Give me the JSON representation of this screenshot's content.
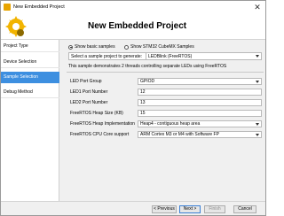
{
  "window": {
    "title": "New Embedded Project",
    "close_glyph": "✕"
  },
  "header": {
    "heading": "New Embedded Project"
  },
  "sidebar": {
    "items": [
      {
        "label": "Project Type"
      },
      {
        "label": "Device Selection"
      },
      {
        "label": "Sample Selection",
        "active": true
      },
      {
        "label": "Debug Method"
      }
    ]
  },
  "content": {
    "radio_basic": "Show basic samples",
    "radio_stm32": "Show STM32 CubeMX Samples",
    "select_label": "Select a sample project to generate:",
    "select_value": "LEDBlink (FreeRTOS)",
    "description": "This sample demonstrates 2 threads controlling separate LEDs using FreeRTOS",
    "fields": [
      {
        "label": "LED Port Group",
        "value": "GPIOD",
        "dropdown": true
      },
      {
        "label": "LED1 Port Number",
        "value": "12",
        "dropdown": false
      },
      {
        "label": "LED2 Port Number",
        "value": "13",
        "dropdown": false
      },
      {
        "label": "FreeRTOS Heap Size (KB)",
        "value": "15",
        "dropdown": false
      },
      {
        "label": "FreeRTOS Heap Implementation",
        "value": "Heap4 - contiguous heap area",
        "dropdown": true
      },
      {
        "label": "FreeRTOS CPU Core support",
        "value": "ARM Cortex M3 or M4 with Software FP",
        "dropdown": true
      }
    ]
  },
  "buttons": {
    "previous": "< Previous",
    "next": "Next >",
    "finish": "Finish",
    "cancel": "Cancel"
  },
  "colors": {
    "selection": "#3d8fe0",
    "logo": "#e8a400"
  }
}
